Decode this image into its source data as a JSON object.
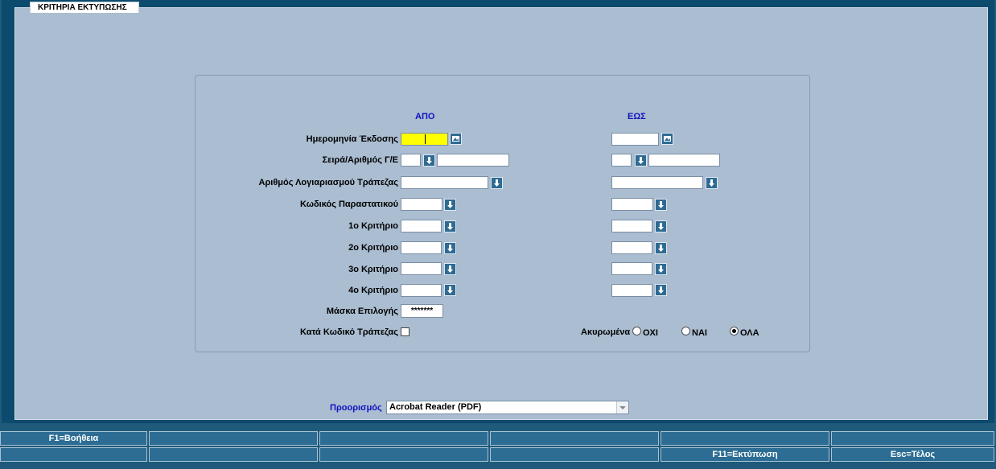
{
  "panel": {
    "title": "ΚΡΙΤΗΡΙΑ ΕΚΤΥΠΩΣΗΣ"
  },
  "columns": {
    "from": "ΑΠΟ",
    "to": "ΕΩΣ"
  },
  "fields": {
    "issue_date": "Ημερομηνία Έκδοσης",
    "series_number": "Σειρά/Αριθμός Γ/Ε",
    "bank_account": "Αριθμός Λογιαριασμού Τράπεζας",
    "document_code": "Κωδικός Παραστατικού",
    "criterion1": "1ο Κριτήριο",
    "criterion2": "2ο Κριτήριο",
    "criterion3": "3ο Κριτήριο",
    "criterion4": "4ο Κριτήριο",
    "selection_mask": "Μάσκα Επιλογής",
    "by_bank_code": "Κατά Κωδικό Τράπεζας"
  },
  "mask_value": "*******",
  "cancelled": {
    "label": "Ακυρωμένα",
    "options": [
      "ΟΧΙ",
      "ΝΑΙ",
      "ΟΛΑ"
    ],
    "selected": "ΟΛΑ"
  },
  "destination": {
    "label": "Προορισμός",
    "value": "Acrobat Reader (PDF)"
  },
  "fkeys": {
    "help": "F1=Βοήθεια",
    "print": "F11=Εκτύπωση",
    "exit": "Esc=Τέλος"
  },
  "colors": {
    "accent_blue": "#1010c0",
    "highlight": "#ffff00",
    "panel": "#aabdd1"
  }
}
